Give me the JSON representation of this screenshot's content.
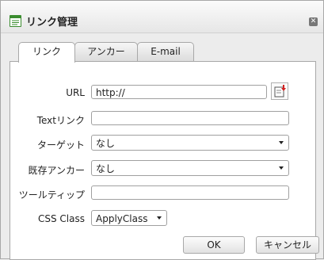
{
  "dialog": {
    "title": "リンク管理"
  },
  "tabs": [
    {
      "label": "リンク",
      "active": true
    },
    {
      "label": "アンカー",
      "active": false
    },
    {
      "label": "E-mail",
      "active": false
    }
  ],
  "form": {
    "url": {
      "label": "URL",
      "value": "http://"
    },
    "text": {
      "label": "Textリンク",
      "value": ""
    },
    "target": {
      "label": "ターゲット",
      "value": "なし"
    },
    "anchor": {
      "label": "既存アンカー",
      "value": "なし"
    },
    "tooltip": {
      "label": "ツールティップ",
      "value": ""
    },
    "css_class": {
      "label": "CSS Class",
      "value": "ApplyClass"
    }
  },
  "buttons": {
    "ok": "OK",
    "cancel": "キャンセル"
  },
  "colors": {
    "icon_green": "#3a8c2e",
    "accent_red": "#d22222"
  }
}
